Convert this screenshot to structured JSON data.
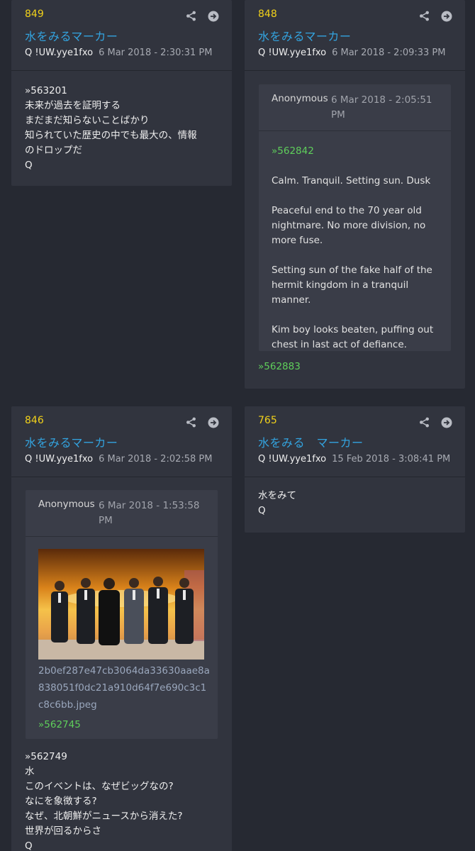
{
  "posts": [
    {
      "number": "849",
      "title": "水をみるマーカー",
      "author": "Q  !UW.yye1fxo",
      "date": "6 Mar 2018 - 2:30:31 PM",
      "lines": [
        "»563201",
        "未来が過去を証明する",
        "まだまだ知らないことばかり",
        "知られていた歴史の中でも最大の、情報",
        "のドロップだ",
        "Q"
      ]
    },
    {
      "number": "848",
      "title": "水をみるマーカー",
      "author": "Q  !UW.yye1fxo",
      "date": "6 Mar 2018 - 2:09:33 PM",
      "quote": {
        "author": "Anonymous",
        "date_line1": "6 Mar 2018 - 2:05:51",
        "date_line2": "PM",
        "ref": "»562842",
        "paragraphs": [
          [
            "Calm. Tranquil. Setting sun. Dusk"
          ],
          [
            "Peaceful end to the 70 year old",
            "nightmare. No more division, no",
            "more fuse."
          ],
          [
            "Setting sun of the fake half of the",
            "hermit kingdom in a tranquil manner."
          ],
          [
            "Kim boy looks beaten, puffing out",
            "chest in last act of defiance."
          ]
        ]
      },
      "reply_ref": "»562883"
    },
    {
      "number": "846",
      "title": "水をみるマーカー",
      "author": "Q  !UW.yye1fxo",
      "date": "6 Mar 2018 - 2:02:58 PM",
      "quote": {
        "author": "Anonymous",
        "date_line1": "6 Mar 2018 - 1:53:58",
        "date_line2": "PM",
        "filename": [
          "2b0ef287e47cb3064da33630aae8a",
          "838051f0dc21a910d64f7e690c3c1",
          "c8c6bb.jpeg"
        ],
        "ref": "»562745"
      },
      "lines": [
        "»562749",
        "水",
        "このイベントは、なぜビッグなの?",
        "なにを象徴する?",
        "なぜ、北朝鮮がニュースから消えた?",
        "世界が回るからさ",
        "Q"
      ]
    },
    {
      "number": "765",
      "title": "水をみる　マーカー",
      "author": "Q  !UW.yye1fxo",
      "date": "15 Feb 2018 - 3:08:41 PM",
      "lines": [
        "水をみて",
        "Q"
      ]
    }
  ],
  "colors": {
    "background": "#262932",
    "card": "#31343e",
    "number": "#f2d21a",
    "title": "#33a4e0",
    "ref_green": "#5fcf5b"
  },
  "icons": [
    "share-icon",
    "arrow-right-circle-icon"
  ]
}
